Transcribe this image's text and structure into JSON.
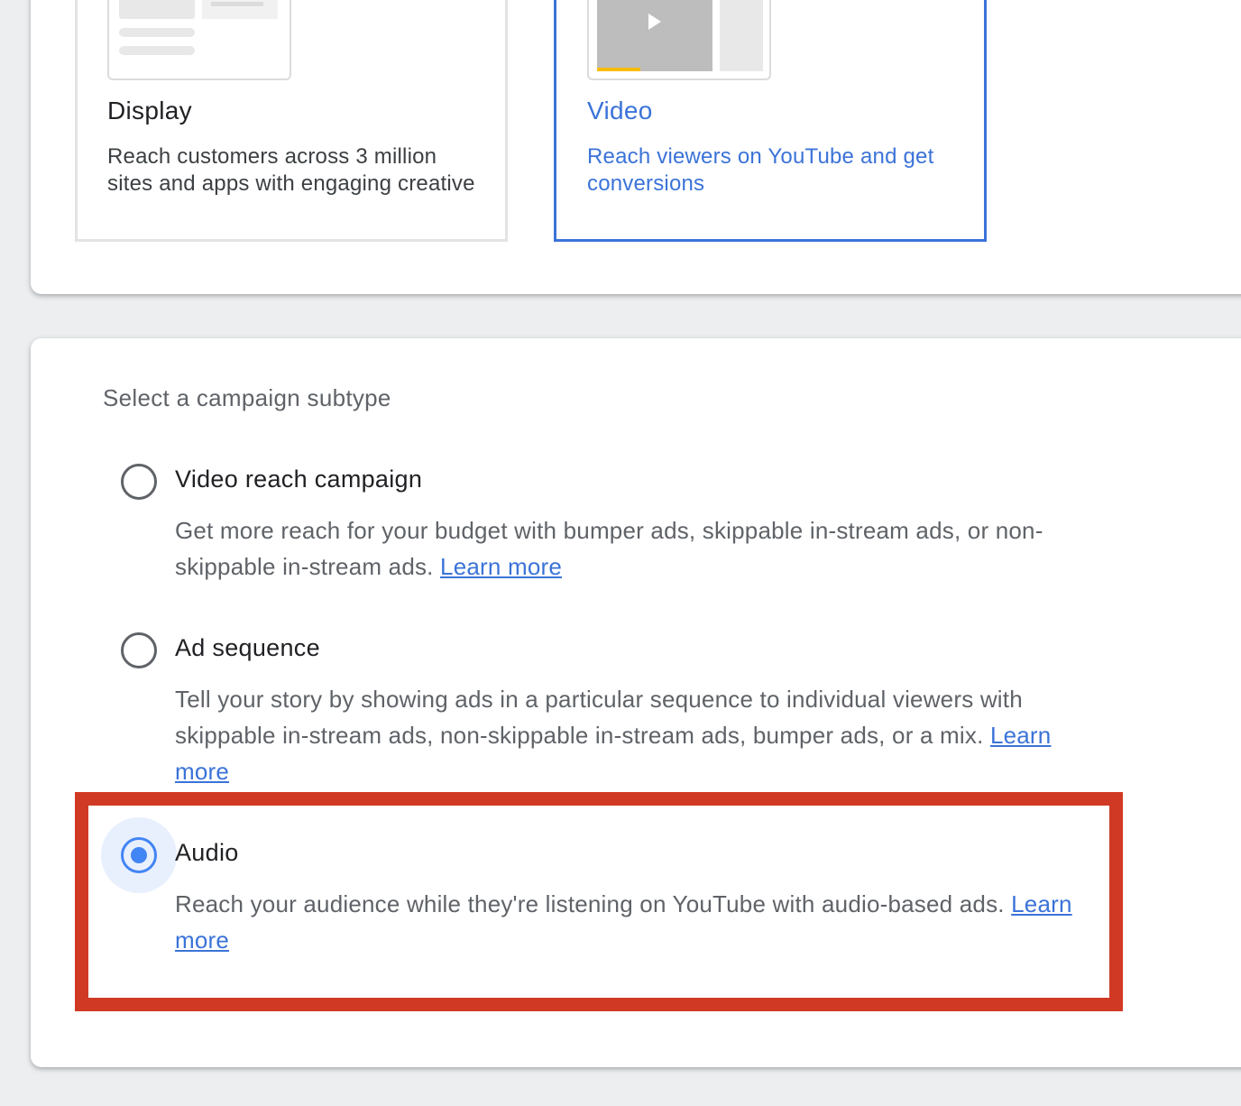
{
  "campaign_types": {
    "display": {
      "title": "Display",
      "description": "Reach customers across 3 million sites and apps with engaging creative"
    },
    "video": {
      "title": "Video",
      "description": "Reach viewers on YouTube and get conversions"
    }
  },
  "subtype_section": {
    "title": "Select a campaign subtype",
    "options": [
      {
        "title": "Video reach campaign",
        "description": "Get more reach for your budget with bumper ads, skippable in-stream ads, or non-skippable in-stream ads.",
        "link": "Learn more",
        "selected": false
      },
      {
        "title": "Ad sequence",
        "description": "Tell your story by showing ads in a particular sequence to individual viewers with skippable in-stream ads, non-skippable in-stream ads, bumper ads, or a mix.",
        "link": "Learn more",
        "selected": false
      },
      {
        "title": "Audio",
        "description": "Reach your audience while they're listening on YouTube with audio-based ads.",
        "link": "Learn more",
        "selected": true
      }
    ]
  },
  "colors": {
    "accent_blue": "#3b73d8",
    "radio_blue": "#4285f4",
    "highlight_red": "#d03a25"
  }
}
